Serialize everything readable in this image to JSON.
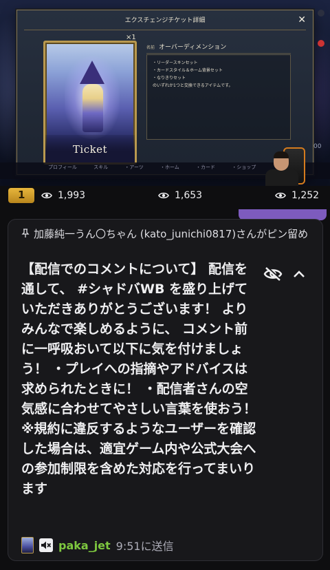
{
  "stream": {
    "dialog_title": "エクスチェンジチケット詳細",
    "close_glyph": "✕",
    "quantity": "×1",
    "card_label": "Ticket",
    "name_label": "名前",
    "item_name": "オーバーディメンション",
    "description_lines": [
      "・リーダースキンセット",
      "・カードスタイル＆ホーム背景セット",
      "・なりきりセット",
      "のいずれか1つと交換できるアイテムです。"
    ],
    "tabs_text": "プロフィール スキル ・アーツ ・ホーム ・カード ・ショップ",
    "side_number": "00"
  },
  "stats": {
    "rank": "1",
    "viewers": [
      "1,993",
      "1,653",
      "1,252"
    ]
  },
  "pinned": {
    "header": "加藤純一うん〇ちゃん (kato_junichi0817)さんがピン留め",
    "message": "【配信でのコメントについて】 配信を通して、 #シャドバWB を盛り上げていただきありがとうございます！ よりみんなで楽しめるように、 コメント前に一呼吸おいて以下に気を付けましょう！ ・プレイへの指摘やアドバイスは求められたときに！ ・配信者さんの空気感に合わせてやさしい言葉を使おう！ ※規約に違反するようなユーザーを確認した場合は、適宜ゲーム内や公式大会への参加制限を含めた対応を行ってまいります",
    "username": "paka_jet",
    "sent_time": "9:51に送信"
  },
  "colors": {
    "background": "#0e0e10",
    "card": "#18181b",
    "username": "#7ec83f",
    "accent_purple": "#7d5bbe",
    "rank_gold": "#e7b63c"
  },
  "icons": [
    "pin-icon",
    "eye-icon",
    "eye-off-icon",
    "chevron-up-icon",
    "mute-icon",
    "close-icon"
  ]
}
